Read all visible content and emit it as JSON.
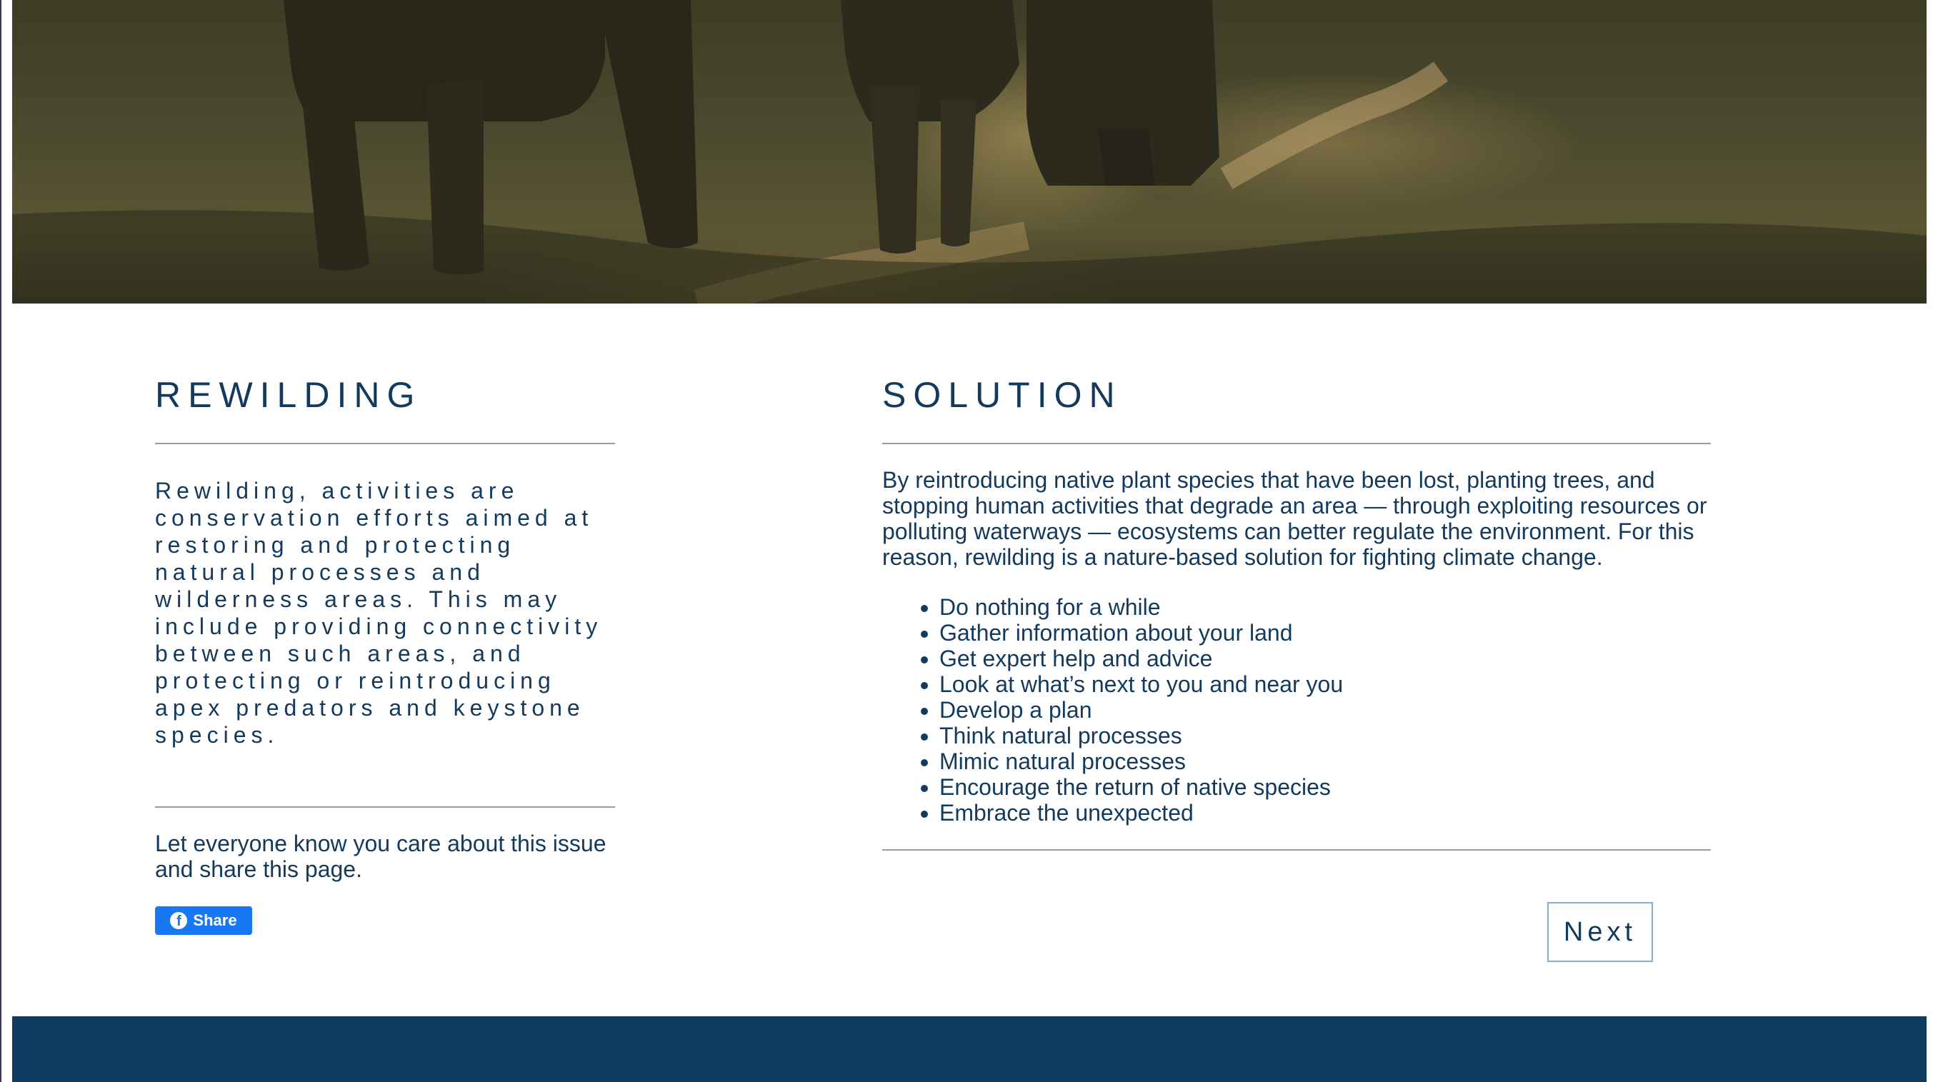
{
  "hero": {
    "image_subject": "elephants walking on a dusty savanna path at sunset"
  },
  "rewilding": {
    "heading": "REWILDING",
    "body": "Rewilding, activities are conservation efforts aimed at restoring and protecting natural processes and wilderness areas. This may include providing connectivity between such areas, and protecting or reintroducing apex predators and keystone species.",
    "share_text": "Let everyone know you care about this issue and share this page.",
    "share_button_label": "Share"
  },
  "solution": {
    "heading": "SOLUTION",
    "body": "By reintroducing native plant species that have been lost, planting trees, and stopping human activities that degrade an area — through exploiting resources or polluting waterways — ecosystems can better regulate the environment. For this reason, rewilding is a nature-based solution for fighting climate change.",
    "steps": [
      "Do nothing for a while",
      "Gather information about your land",
      "Get expert help and advice",
      "Look at what’s next to you and near you",
      "Develop a plan",
      "Think natural processes",
      "Mimic natural processes",
      "Encourage the return of native species",
      "Embrace the unexpected"
    ],
    "next_button_label": "Next"
  },
  "colors": {
    "heading_text": "#133a5c",
    "footer": "#0f3a60",
    "facebook": "#1877f2",
    "next_border": "#7fb1d0"
  }
}
